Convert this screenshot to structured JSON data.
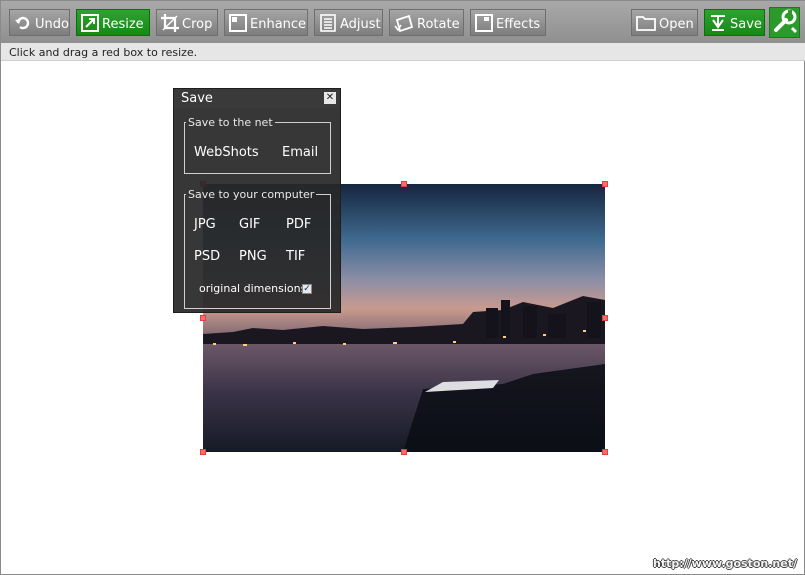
{
  "toolbar": {
    "tools": [
      {
        "label": "Undo",
        "icon": "undo-icon",
        "active": false
      },
      {
        "label": "Resize",
        "icon": "resize-icon",
        "active": true
      },
      {
        "label": "Crop",
        "icon": "crop-icon",
        "active": false
      },
      {
        "label": "Enhance",
        "icon": "enhance-icon",
        "active": false
      },
      {
        "label": "Adjust",
        "icon": "adjust-icon",
        "active": false
      },
      {
        "label": "Rotate",
        "icon": "rotate-icon",
        "active": false
      },
      {
        "label": "Effects",
        "icon": "effects-icon",
        "active": false
      }
    ],
    "open_label": "Open",
    "save_label": "Save",
    "wrench_icon": "wrench-icon",
    "accent_color": "#1f961f"
  },
  "hint": "Click and drag a red box to resize.",
  "save_panel": {
    "title": "Save",
    "close_icon": "close-icon",
    "net_group": {
      "legend": "Save to the net",
      "options": [
        "WebShots",
        "Email"
      ]
    },
    "computer_group": {
      "legend": "Save to your computer",
      "formats": [
        "JPG",
        "GIF",
        "PDF",
        "PSD",
        "PNG",
        "TIF"
      ],
      "original_dimensions_label": "original dimensions",
      "original_dimensions_checked": true
    }
  },
  "image": {
    "description_name": "city-waterfront-dusk-photo",
    "handle_color": "#ff6a6a"
  },
  "credit": "http://www.goston.net/"
}
